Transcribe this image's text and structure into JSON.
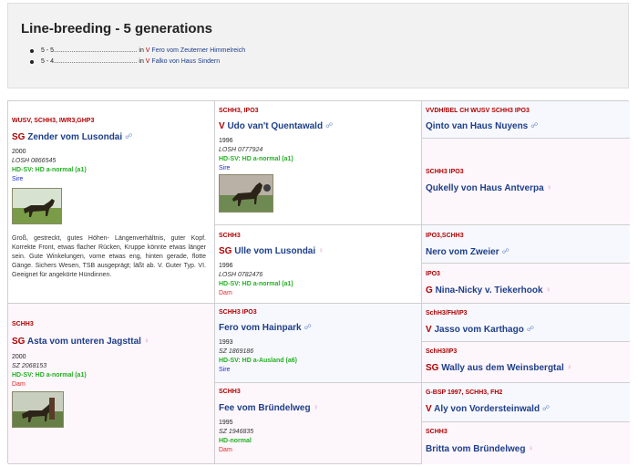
{
  "header": {
    "title": "Line-breeding - 5 generations",
    "lines": [
      {
        "gen": "5 - 5",
        "dots": "...............................................",
        "in_text": "in",
        "prefix": "V",
        "dog": "Fero vom Zeuterner Himmelreich"
      },
      {
        "gen": "5 - 4",
        "dots": "...............................................",
        "in_text": "in",
        "prefix": "V",
        "dog": "Falko von Haus Sindern"
      }
    ]
  },
  "colors": {
    "titles": "#b00000",
    "name": "#1d3f8a",
    "hd": "#23b023",
    "sire": "#1f2fcc",
    "dam": "#e02a2a",
    "male_icon": "#6d8ec6",
    "female_icon": "#d991c6"
  },
  "pedigree": {
    "sire": {
      "titles": "WUSV, SCHH3, IWR3,GHP3",
      "prefix": "SG",
      "name": "Zender vom Lusondai",
      "sex_icon": "male-icon",
      "year": "2000",
      "reg": "LOSH 0866545",
      "hd": "HD-SV: HD a-normal (a1)",
      "role": "Sire",
      "description": "Groß, gestreckt, gutes Höhen- Längenverhältnis, guter Kopf. Korrekte Front, etwas flacher Rücken, Kruppe könnte etwas länger sein. Gute Winkelungen, vorne etwas eng, hinten gerade, flotte Gänge. Sichers Wesen, TSB ausgeprägt; läßt ab. V. Guter Typ. VI. Geeignet für angekörte Hündinnen."
    },
    "dam": {
      "titles": "SCHH3",
      "prefix": "SG",
      "name": "Asta vom unteren Jagsttal",
      "sex_icon": "female-icon",
      "year": "2000",
      "reg": "SZ 2068153",
      "hd": "HD-SV: HD a-normal (a1)",
      "role": "Dam"
    },
    "ss": {
      "titles": "SCHH3, IPO3",
      "prefix": "V",
      "name": "Udo van't Quentawald",
      "sex_icon": "male-icon",
      "year": "1996",
      "reg": "LOSH 0777924",
      "hd": "HD-SV: HD a-normal (a1)",
      "role": "Sire"
    },
    "sd": {
      "titles": "SCHH3",
      "prefix": "SG",
      "name": "Ulle vom Lusondai",
      "sex_icon": "female-icon",
      "year": "1996",
      "reg": "LOSH 0782476",
      "hd": "HD-SV: HD a-normal (a1)",
      "role": "Dam"
    },
    "ds": {
      "titles": "SCHH3 IPO3",
      "prefix": "",
      "name": "Fero vom Hainpark",
      "sex_icon": "male-icon",
      "year": "1993",
      "reg": "SZ 1869186",
      "hd": "HD-SV: HD a-Ausland (a6)",
      "role": "Sire"
    },
    "dd": {
      "titles": "SCHH3",
      "prefix": "",
      "name": "Fee vom Bründelweg",
      "sex_icon": "female-icon",
      "year": "1995",
      "reg": "SZ 1946835",
      "hd": "HD-normal",
      "role": "Dam"
    },
    "sss": {
      "titles": "VVDH/BEL CH WUSV SCHH3 IPO3",
      "prefix": "",
      "name": "Qinto van Haus Nuyens",
      "sex_icon": "male-icon"
    },
    "ssd": {
      "titles": "SCHH3 IPO3",
      "prefix": "",
      "name": "Qukelly von Haus Antverpa",
      "sex_icon": "female-icon"
    },
    "sds": {
      "titles": "IPO3,SCHH3",
      "prefix": "",
      "name": "Nero vom Zweier",
      "sex_icon": "male-icon"
    },
    "sdd": {
      "titles": "IPO3",
      "prefix": "G",
      "name": "Nina-Nicky v. Tiekerhook",
      "sex_icon": "female-icon"
    },
    "dss": {
      "titles": "SchH3/FH/IP3",
      "prefix": "V",
      "name": "Jasso vom Karthago",
      "sex_icon": "male-icon"
    },
    "dsd": {
      "titles": "SchH3/IP3",
      "prefix": "SG",
      "name": "Wally aus dem Weinsbergtal",
      "sex_icon": "female-icon"
    },
    "dds": {
      "titles": "G-BSP 1997, SCHH3, FH2",
      "prefix": "V",
      "name": "Aly von Vordersteinwald",
      "sex_icon": "male-icon"
    },
    "ddd": {
      "titles": "SCHH3",
      "prefix": "",
      "name": "Britta vom Bründelweg",
      "sex_icon": "female-icon"
    }
  }
}
